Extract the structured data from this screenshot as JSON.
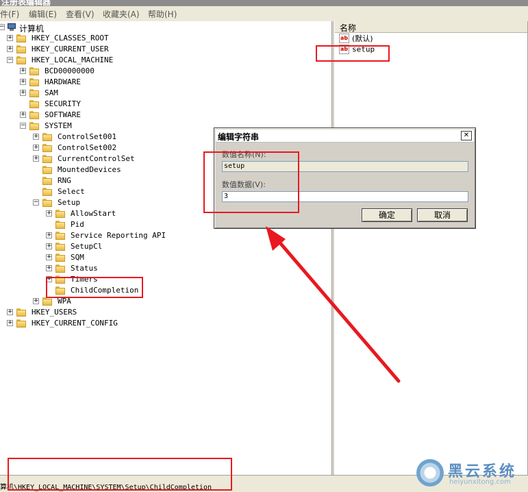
{
  "window": {
    "title": "注册表编辑器"
  },
  "menu": [
    "件(F)",
    "编辑(E)",
    "查看(V)",
    "收藏夹(A)",
    "帮助(H)"
  ],
  "tree": {
    "root": "计算机",
    "nodes": [
      {
        "label": "HKEY_CLASSES_ROOT",
        "expander": "+"
      },
      {
        "label": "HKEY_CURRENT_USER",
        "expander": "+"
      },
      {
        "label": "HKEY_LOCAL_MACHINE",
        "expander": "−"
      },
      {
        "label": "BCD00000000",
        "expander": "+"
      },
      {
        "label": "HARDWARE",
        "expander": "+"
      },
      {
        "label": "SAM",
        "expander": "+"
      },
      {
        "label": "SECURITY",
        "expander": ""
      },
      {
        "label": "SOFTWARE",
        "expander": "+"
      },
      {
        "label": "SYSTEM",
        "expander": "−"
      },
      {
        "label": "ControlSet001",
        "expander": "+"
      },
      {
        "label": "ControlSet002",
        "expander": "+"
      },
      {
        "label": "CurrentControlSet",
        "expander": "+"
      },
      {
        "label": "MountedDevices",
        "expander": ""
      },
      {
        "label": "RNG",
        "expander": ""
      },
      {
        "label": "Select",
        "expander": ""
      },
      {
        "label": "Setup",
        "expander": "−"
      },
      {
        "label": "AllowStart",
        "expander": "+"
      },
      {
        "label": "Pid",
        "expander": ""
      },
      {
        "label": "Service Reporting API",
        "expander": "+"
      },
      {
        "label": "SetupCl",
        "expander": "+"
      },
      {
        "label": "SQM",
        "expander": "+"
      },
      {
        "label": "Status",
        "expander": "+"
      },
      {
        "label": "Timers",
        "expander": "+"
      },
      {
        "label": "ChildCompletion",
        "expander": ""
      },
      {
        "label": "WPA",
        "expander": "+"
      },
      {
        "label": "HKEY_USERS",
        "expander": "+"
      },
      {
        "label": "HKEY_CURRENT_CONFIG",
        "expander": "+"
      }
    ]
  },
  "values_pane": {
    "column_name": "名称",
    "rows": [
      {
        "icon": "ab",
        "name": "(默认)"
      },
      {
        "icon": "ab",
        "name": "setup"
      }
    ]
  },
  "dialog": {
    "title": "编辑字符串",
    "close": "✕",
    "name_label": "数值名称(N):",
    "name_value": "setup",
    "data_label": "数值数据(V):",
    "data_value": "3",
    "ok": "确定",
    "cancel": "取消"
  },
  "status": {
    "path": "算机\\HKEY_LOCAL_MACHINE\\SYSTEM\\Setup\\ChildCompletion"
  },
  "watermark": {
    "main": "黑云系统",
    "sub": "heiyunxitong.com"
  },
  "colors": {
    "highlight": "#e8191f",
    "dialog_bg": "#d4d0c8",
    "watermark": "#5d8fc1"
  }
}
